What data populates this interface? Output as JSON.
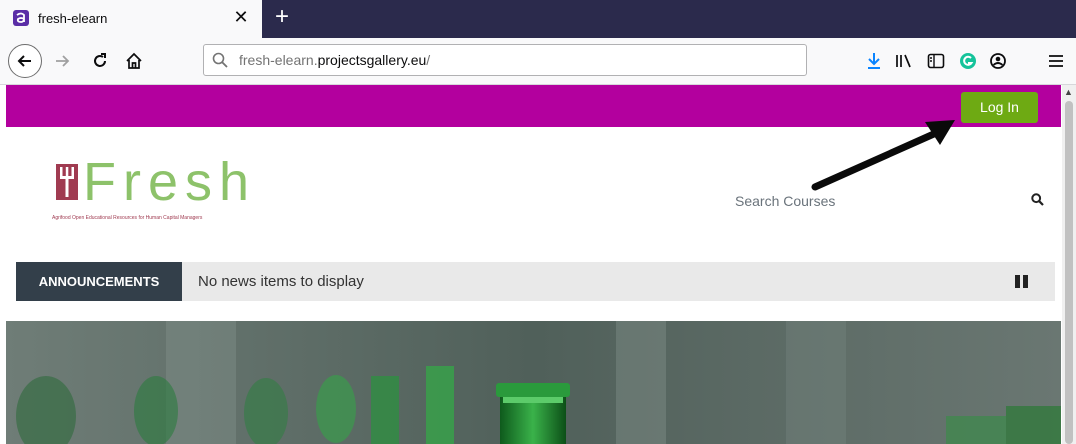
{
  "browser": {
    "tab_title": "fresh-elearn",
    "url_domain_prefix": "fresh-elearn.",
    "url_domain_main": "projectsgallery.eu",
    "url_path": "/"
  },
  "site": {
    "login_label": "Log In",
    "logo_word": "Fresh",
    "logo_tagline": "Agrifood Open Educational Resources for Human Capital Managers",
    "search_placeholder": "Search Courses",
    "announcements_title": "ANNOUNCEMENTS",
    "announcements_text": "No news items to display"
  },
  "colors": {
    "topbar": "#b3009e",
    "login_button": "#6eaa13",
    "announcements_title_bg": "#333f4a",
    "logo_green": "#8dc26a",
    "logo_red": "#a03b51"
  }
}
